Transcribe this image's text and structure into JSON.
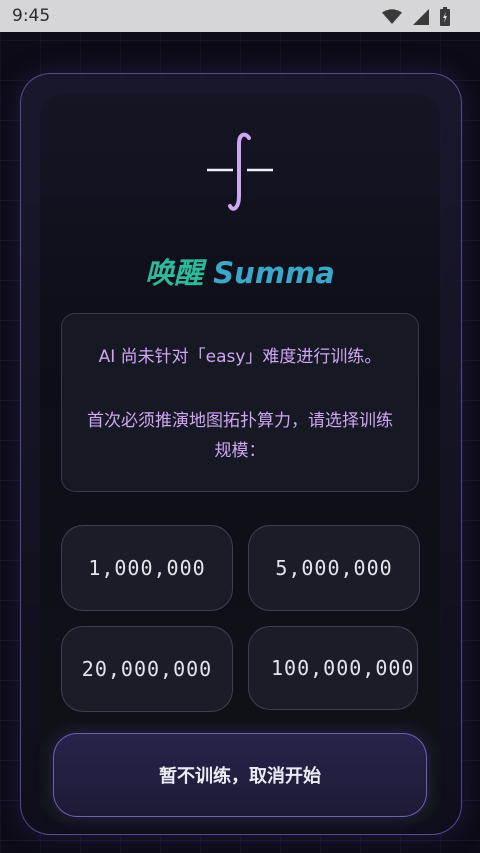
{
  "status_bar": {
    "time": "9:45",
    "icons": [
      "wifi-icon",
      "signal-icon",
      "battery-charging-icon"
    ]
  },
  "logo": {
    "icon": "integral-icon",
    "color": "#cfa6f3"
  },
  "title": {
    "cn": "唤醒",
    "en": "Summa"
  },
  "message": {
    "line1": "AI 尚未针对「easy」难度进行训练。",
    "line2": "首次必须推演地图拓扑算力，请选择训练规模："
  },
  "options": [
    {
      "label": "1,000,000"
    },
    {
      "label": "5,000,000"
    },
    {
      "label": "20,000,000"
    },
    {
      "label": "100,000,000"
    }
  ],
  "skip_button": {
    "label": "暂不训练，取消开始"
  },
  "colors": {
    "accent_purple": "#cfa6f3",
    "title_green": "#2fb89a",
    "title_blue": "#3aa8c8"
  }
}
